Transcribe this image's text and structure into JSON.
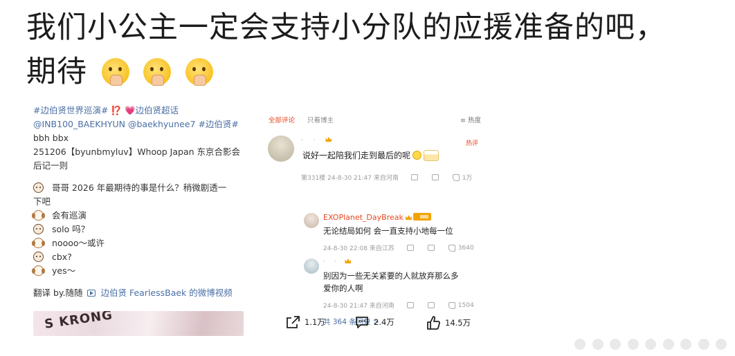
{
  "headline": {
    "line1": "我们小公主一定会支持小分队的应援准备的吧，",
    "line2": "期待",
    "emoji_icon": "pray-face-emoji",
    "emoji_count": 3
  },
  "post": {
    "hashtags": "#边伯贤世界巡演# ⁉️ 💗边伯贤超话",
    "mentions": "@INB100_BAEKHYUN @baekhyunee7 #边伯贤#",
    "bbh": "bbh bbx",
    "event": "251206【byunbmyluv】Whoop Japan 东京合影会",
    "event_cont": "后记一则",
    "dialogue": [
      {
        "speaker": "girl",
        "text": "哥哥 2026 年最期待的事是什么？稍微剧透一"
      },
      {
        "speaker": "none",
        "text": "下吧"
      },
      {
        "speaker": "dog",
        "text": "会有巡演"
      },
      {
        "speaker": "girl",
        "text": "solo 吗？"
      },
      {
        "speaker": "dog",
        "text": "noooo～或许"
      },
      {
        "speaker": "girl",
        "text": "cbx?"
      },
      {
        "speaker": "dog",
        "text": "yes～"
      }
    ],
    "translate_prefix": "翻译 by.随随",
    "translate_link": "边伯贤 FearlessBaek 的微博视频",
    "thumb_text": "S KRONG"
  },
  "comments": {
    "tab_all": "全部评论",
    "tab_owner": "只看博主",
    "tab_hot": "≡ 热度",
    "main": {
      "hot": "热评",
      "text": "说好一起陪我们走到最后的呢",
      "floor": "第331楼 24-8-30 21:47 来自河南",
      "likes": "1万"
    },
    "reply1": {
      "name": "EXOPlanet_DayBreak",
      "text": "无论结局如何 会一直支持小地每一位",
      "meta": "24-8-30 22:08 来自江苏",
      "likes": "3640"
    },
    "reply2": {
      "text": "别因为一些无关紧要的人就放弃那么多爱你的人啊",
      "meta": "24-8-30 21:47 来自河南",
      "likes": "1504"
    },
    "more": "共 364 条回复 >"
  },
  "actions": {
    "share": "1.1万",
    "comment": "2.4万",
    "like": "14.5万"
  }
}
